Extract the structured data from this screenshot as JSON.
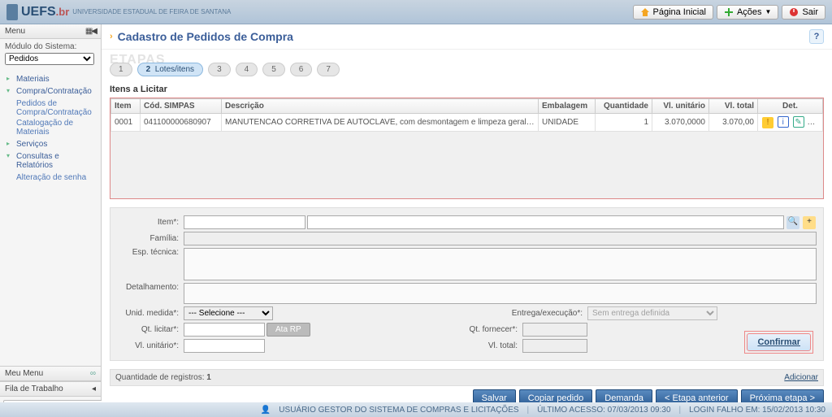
{
  "brand": {
    "name": "UEFS",
    "suffix": "br",
    "subtitle": "UNIVERSIDADE ESTADUAL DE FEIRA DE SANTANA"
  },
  "topbar": {
    "home": "Página Inicial",
    "actions": "Ações",
    "exit": "Sair"
  },
  "sidebar": {
    "menu_header": "Menu",
    "module_label": "Módulo do Sistema:",
    "module_value": "Pedidos",
    "nodes": {
      "materiais": "Materiais",
      "compra": "Compra/Contratação",
      "pedidos": "Pedidos de Compra/Contratação",
      "catalogacao": "Catalogação de Materiais",
      "servicos": "Serviços",
      "consultas": "Consultas e Relatórios",
      "alt_senha": "Alteração de senha"
    },
    "meu_menu": "Meu Menu",
    "fila": "Fila de Trabalho"
  },
  "page": {
    "title": "Cadastro de Pedidos de Compra",
    "etapas_label": "ETAPAS",
    "steps": [
      "1",
      "2",
      "3",
      "4",
      "5",
      "6",
      "7"
    ],
    "step2_label": "Lotes/itens",
    "section_title": "Itens a Licitar"
  },
  "grid": {
    "headers": {
      "item": "Item",
      "cod": "Cód. SIMPAS",
      "desc": "Descrição",
      "emb": "Embalagem",
      "qtd": "Quantidade",
      "vunit": "Vl. unitário",
      "vtot": "Vl. total",
      "det": "Det."
    },
    "row": {
      "item": "0001",
      "cod": "041100000680907",
      "desc": "MANUTENCAO CORRETIVA DE AUTOCLAVE, com desmontagem e limpeza geral, lubrificacao das engrenagens da porta e teste de",
      "emb": "UNIDADE",
      "qtd": "1",
      "vunit": "3.070,0000",
      "vtot": "3.070,00"
    }
  },
  "form": {
    "item": "Item*:",
    "familia": "Família:",
    "esp": "Esp. técnica:",
    "detalhamento": "Detalhamento:",
    "unid": "Unid. medida*:",
    "unid_sel": "--- Selecione ---",
    "entrega": "Entrega/execução*:",
    "entrega_sel": "Sem entrega definida",
    "qt_licitar": "Qt. licitar*:",
    "ata_rp": "Ata RP",
    "qt_fornecer": "Qt. fornecer*:",
    "vl_unit": "Vl. unitário*:",
    "vl_total": "Vl. total:",
    "confirmar": "Confirmar"
  },
  "regbar": {
    "label": "Quantidade de registros:",
    "count": "1",
    "add": "Adicionar"
  },
  "actionbar": {
    "salvar": "Salvar",
    "copiar": "Copiar pedido",
    "demanda": "Demanda",
    "prev": "< Etapa anterior",
    "next": "Próxima etapa >"
  },
  "status": {
    "user": "USUÁRIO GESTOR DO SISTEMA DE COMPRAS E LICITAÇÕES",
    "last": "ÚLTIMO ACESSO: 07/03/2013 09:30",
    "fail": "LOGIN FALHO EM: 15/02/2013 10:30"
  }
}
